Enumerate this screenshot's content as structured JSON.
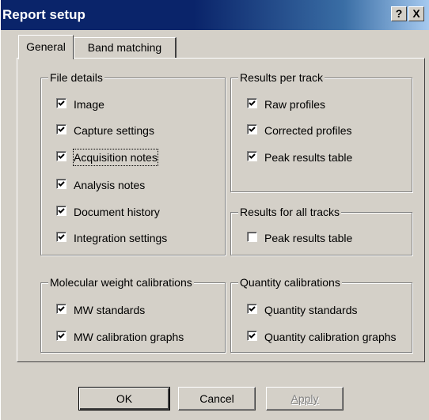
{
  "window": {
    "title": "Report setup",
    "help_label": "?",
    "close_label": "X"
  },
  "tabs": [
    {
      "label": "General",
      "active": true
    },
    {
      "label": "Band matching",
      "active": false
    }
  ],
  "groups": {
    "file_details": {
      "title": "File details",
      "items": [
        {
          "label": "Image",
          "checked": true
        },
        {
          "label": "Capture settings",
          "checked": true
        },
        {
          "label": "Acquisition notes",
          "checked": true
        },
        {
          "label": "Analysis notes",
          "checked": true
        },
        {
          "label": "Document history",
          "checked": true
        },
        {
          "label": "Integration settings",
          "checked": true
        }
      ]
    },
    "results_per_track": {
      "title": "Results per track",
      "items": [
        {
          "label": "Raw profiles",
          "checked": true
        },
        {
          "label": "Corrected profiles",
          "checked": true
        },
        {
          "label": "Peak results table",
          "checked": true
        }
      ]
    },
    "results_all_tracks": {
      "title": "Results for all tracks",
      "items": [
        {
          "label": "Peak results table",
          "checked": false
        }
      ]
    },
    "mw_calibrations": {
      "title": "Molecular weight calibrations",
      "items": [
        {
          "label": "MW standards",
          "checked": true
        },
        {
          "label": "MW calibration graphs",
          "checked": true
        }
      ]
    },
    "quantity_calibrations": {
      "title": "Quantity calibrations",
      "items": [
        {
          "label": "Quantity standards",
          "checked": true
        },
        {
          "label": "Quantity calibration graphs",
          "checked": true
        }
      ]
    }
  },
  "buttons": {
    "ok": "OK",
    "cancel": "Cancel",
    "apply": "Apply"
  }
}
